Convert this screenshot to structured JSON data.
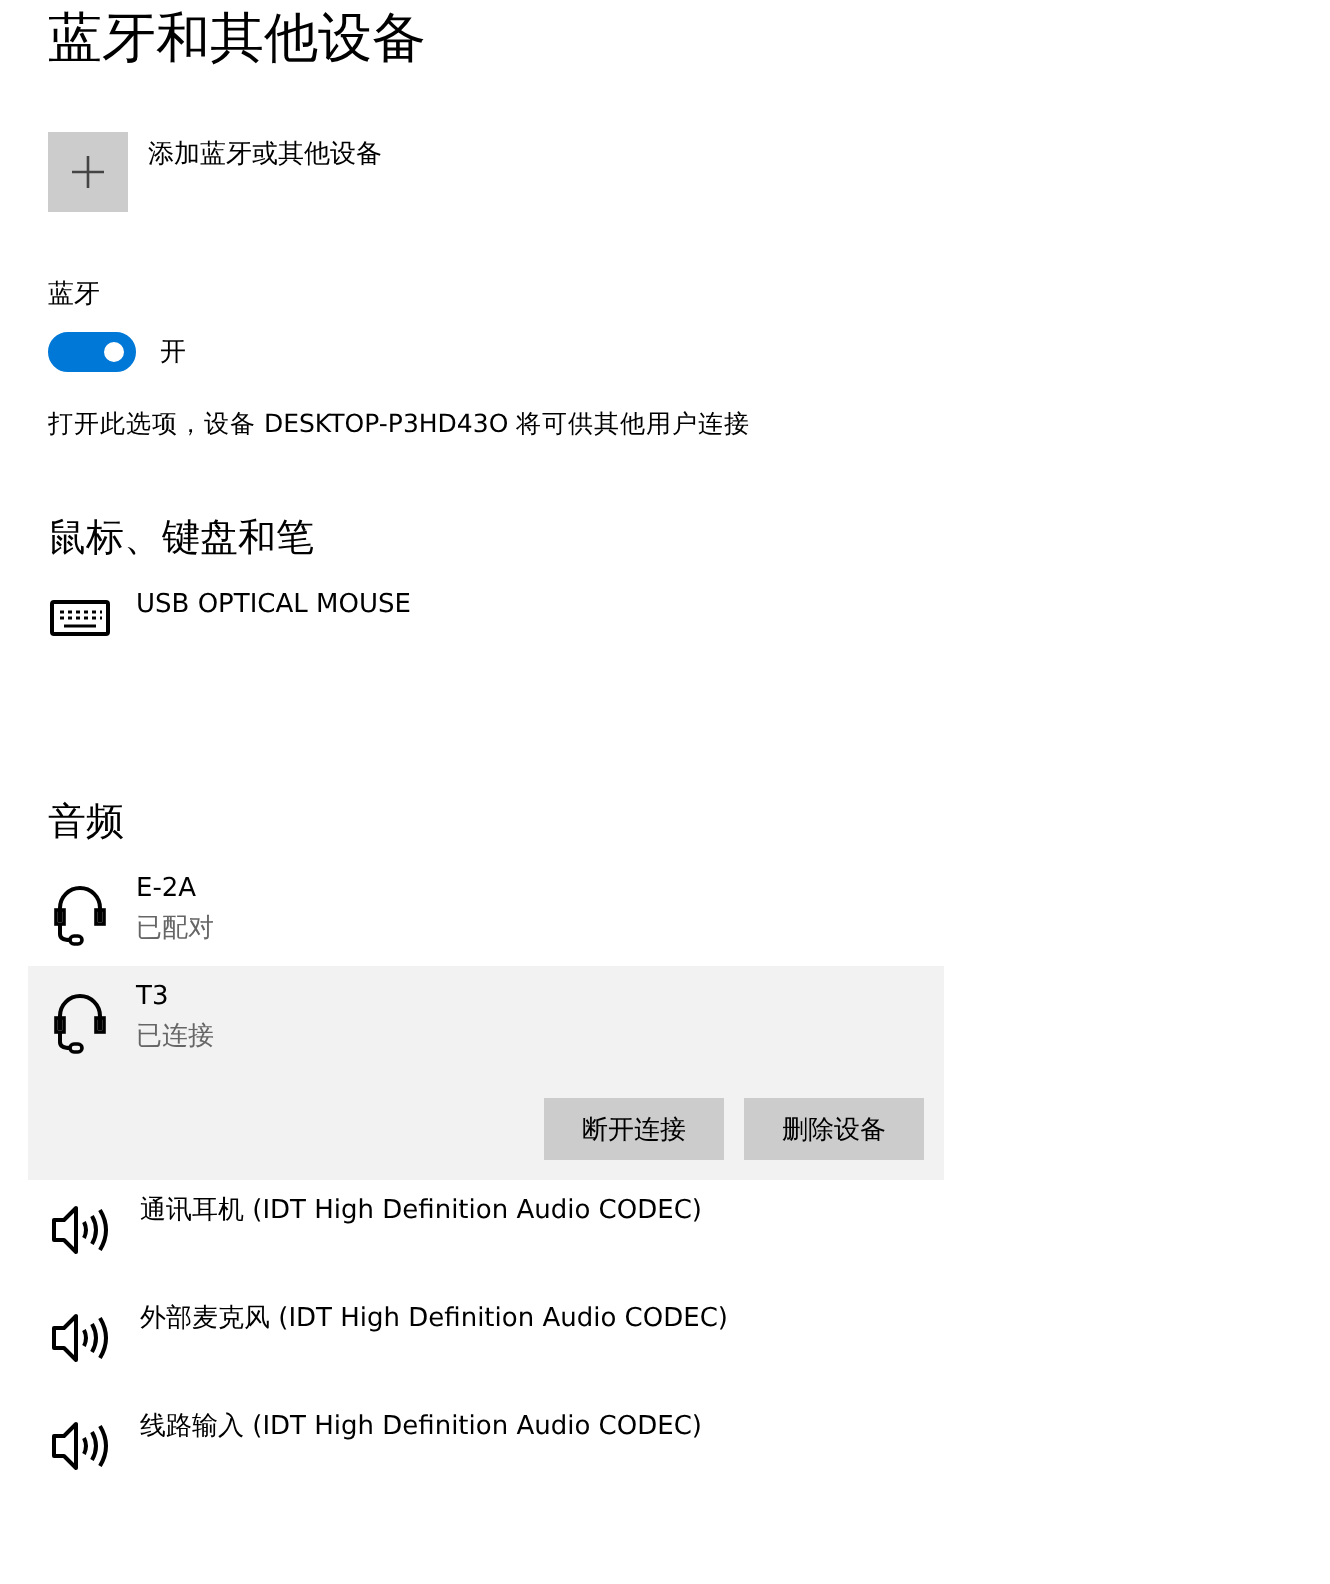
{
  "title": "蓝牙和其他设备",
  "add_device": {
    "label": "添加蓝牙或其他设备"
  },
  "bluetooth": {
    "label": "蓝牙",
    "on": true,
    "state_text": "开",
    "description": "打开此选项，设备 DESKTOP-P3HD43O 将可供其他用户连接"
  },
  "sections": [
    {
      "heading": "鼠标、键盘和笔",
      "devices": [
        {
          "kind": "keyboard",
          "name": "USB OPTICAL MOUSE",
          "selected": false
        }
      ]
    },
    {
      "heading": "音频",
      "devices": [
        {
          "kind": "headset",
          "name": "E-2A",
          "status": "已配对",
          "selected": false
        },
        {
          "kind": "headset",
          "name": "T3",
          "status": "已连接",
          "selected": true,
          "actions": [
            "断开连接",
            "删除设备"
          ]
        },
        {
          "kind": "speaker",
          "name": "通讯耳机 (IDT High Definition Audio CODEC)",
          "selected": false
        },
        {
          "kind": "speaker",
          "name": "外部麦克风 (IDT High Definition Audio CODEC)",
          "selected": false
        },
        {
          "kind": "speaker",
          "name": "线路输入 (IDT High Definition Audio CODEC)",
          "selected": false
        }
      ]
    }
  ]
}
